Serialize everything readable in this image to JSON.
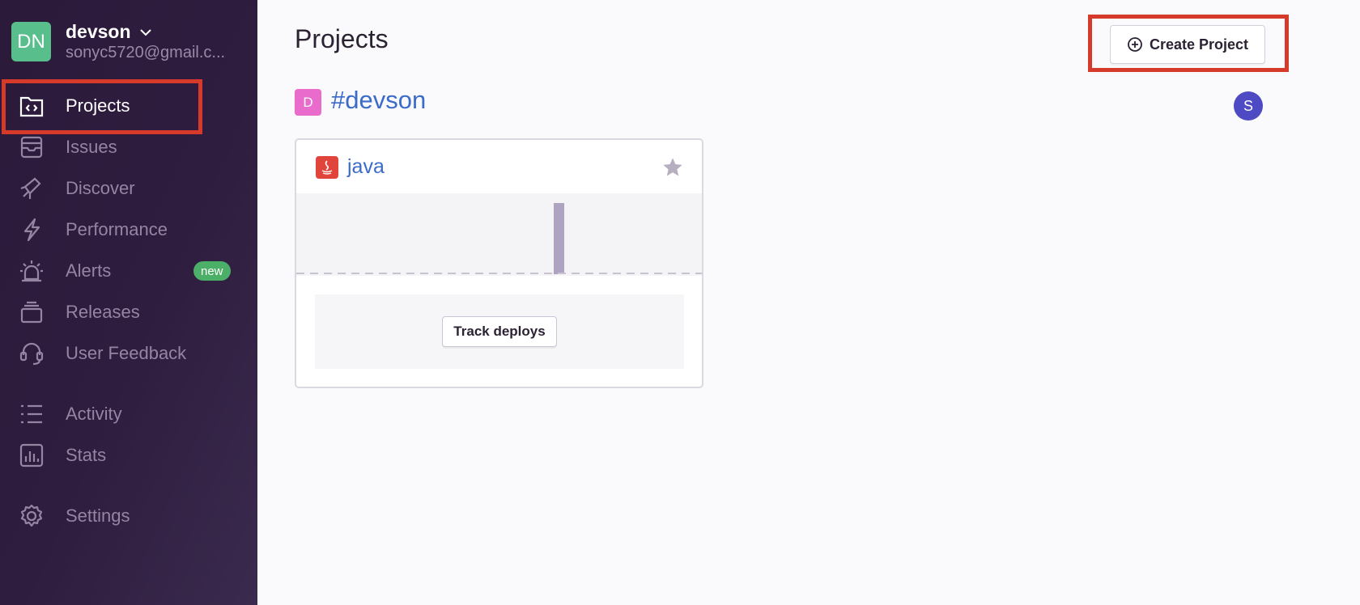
{
  "org": {
    "initials": "DN",
    "name": "devson",
    "email": "sonyc5720@gmail.c..."
  },
  "sidebar": {
    "items": [
      {
        "label": "Projects",
        "icon": "projects-icon"
      },
      {
        "label": "Issues",
        "icon": "issues-icon"
      },
      {
        "label": "Discover",
        "icon": "discover-icon"
      },
      {
        "label": "Performance",
        "icon": "performance-icon"
      },
      {
        "label": "Alerts",
        "icon": "alerts-icon",
        "badge": "new"
      },
      {
        "label": "Releases",
        "icon": "releases-icon"
      },
      {
        "label": "User Feedback",
        "icon": "user-feedback-icon"
      },
      {
        "label": "Activity",
        "icon": "activity-icon"
      },
      {
        "label": "Stats",
        "icon": "stats-icon"
      },
      {
        "label": "Settings",
        "icon": "settings-icon"
      }
    ]
  },
  "main": {
    "title": "Projects",
    "create_button": "Create Project",
    "team": {
      "badge": "D",
      "name": "#devson",
      "member_initial": "S"
    },
    "project": {
      "name": "java",
      "platform_icon": "java-icon",
      "track_button": "Track deploys"
    }
  },
  "colors": {
    "sidebar_bg": "#2f1d3f",
    "org_avatar": "#57be8c",
    "highlight": "#d63a2a",
    "link": "#3b6bc9",
    "team_badge": "#e96bcb",
    "member_avatar": "#4e4ac4",
    "badge_new": "#4caf67"
  }
}
